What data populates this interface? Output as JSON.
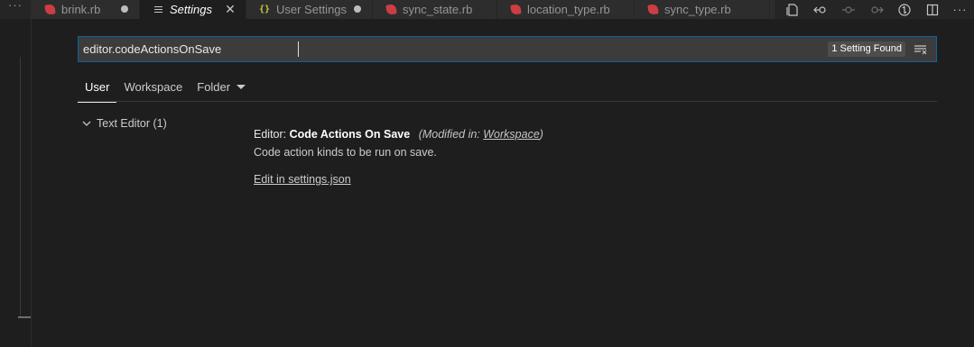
{
  "tabs": [
    {
      "label": "brink.rb",
      "icon": "ruby-icon",
      "dirty": true
    },
    {
      "label": "Settings",
      "icon": "settings-lines-icon",
      "active": true
    },
    {
      "label": "User Settings",
      "icon": "json-braces-icon",
      "dirty": true
    },
    {
      "label": "sync_state.rb",
      "icon": "ruby-icon"
    },
    {
      "label": "location_type.rb",
      "icon": "ruby-icon"
    },
    {
      "label": "sync_type.rb",
      "icon": "ruby-icon"
    }
  ],
  "tabbar": {
    "overflow_left": "···",
    "actions_overflow": "···",
    "close_glyph": "✕"
  },
  "search": {
    "value": "editor.codeActionsOnSave",
    "result_count": "1 Setting Found"
  },
  "scopes": {
    "user": "User",
    "workspace": "Workspace",
    "folder": "Folder"
  },
  "toc": {
    "item": "Text Editor (1)"
  },
  "setting": {
    "category": "Editor: ",
    "label": "Code Actions On Save",
    "modified_prefix": "(Modified in: ",
    "modified_link": "Workspace",
    "modified_suffix": ")",
    "description": "Code action kinds to be run on save.",
    "edit_link": "Edit in settings.json"
  },
  "colors": {
    "accent_border": "#0e639c",
    "ruby": "#cc3e44",
    "json": "#cbcb41",
    "background": "#1e1e1e"
  }
}
